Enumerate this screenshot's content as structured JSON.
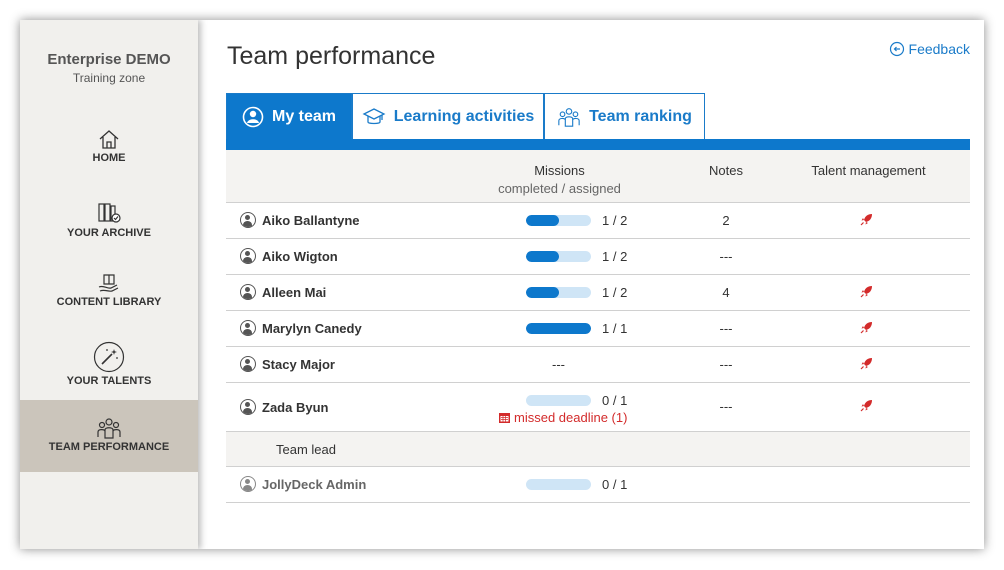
{
  "sidebar": {
    "brand_name": "Enterprise DEMO",
    "brand_sub": "Training zone",
    "items": [
      {
        "label": "HOME",
        "icon": "home-icon",
        "active": false
      },
      {
        "label": "YOUR ARCHIVE",
        "icon": "archive-icon",
        "active": false
      },
      {
        "label": "CONTENT LIBRARY",
        "icon": "library-icon",
        "active": false
      },
      {
        "label": "YOUR TALENTS",
        "icon": "talents-icon",
        "active": false
      },
      {
        "label": "TEAM PERFORMANCE",
        "icon": "team-icon",
        "active": true
      }
    ]
  },
  "header": {
    "title": "Team performance",
    "feedback_label": "Feedback"
  },
  "tabs": [
    {
      "label": "My team",
      "icon": "user-icon",
      "active": true
    },
    {
      "label": "Learning activities",
      "icon": "graduation-icon",
      "active": false
    },
    {
      "label": "Team ranking",
      "icon": "team-icon",
      "active": false
    }
  ],
  "table": {
    "headers": {
      "missions": "Missions",
      "missions_sub": "completed / assigned",
      "notes": "Notes",
      "talent": "Talent management"
    },
    "rows": [
      {
        "name": "Aiko Ballantyne",
        "completed": 1,
        "assigned": 2,
        "ratio": "1 / 2",
        "notes": "2",
        "talent_flag": true
      },
      {
        "name": "Aiko Wigton",
        "completed": 1,
        "assigned": 2,
        "ratio": "1 / 2",
        "notes": "---",
        "talent_flag": false
      },
      {
        "name": "Alleen Mai",
        "completed": 1,
        "assigned": 2,
        "ratio": "1 / 2",
        "notes": "4",
        "talent_flag": true
      },
      {
        "name": "Marylyn Canedy",
        "completed": 1,
        "assigned": 1,
        "ratio": "1 / 1",
        "notes": "---",
        "talent_flag": true
      },
      {
        "name": "Stacy Major",
        "mission_dash": "---",
        "notes": "---",
        "talent_flag": true
      },
      {
        "name": "Zada Byun",
        "completed": 0,
        "assigned": 1,
        "ratio": "0 / 1",
        "notes": "---",
        "talent_flag": true,
        "missed": "missed deadline (1)"
      }
    ],
    "group_label": "Team lead",
    "lead_rows": [
      {
        "name": "JollyDeck Admin",
        "completed": 0,
        "assigned": 1,
        "ratio": "0 / 1"
      }
    ]
  },
  "colors": {
    "accent": "#0d78cc",
    "sidebar_bg": "#f1f0ed",
    "sidebar_active": "#cbc5bb",
    "alert": "#d32b2b"
  }
}
